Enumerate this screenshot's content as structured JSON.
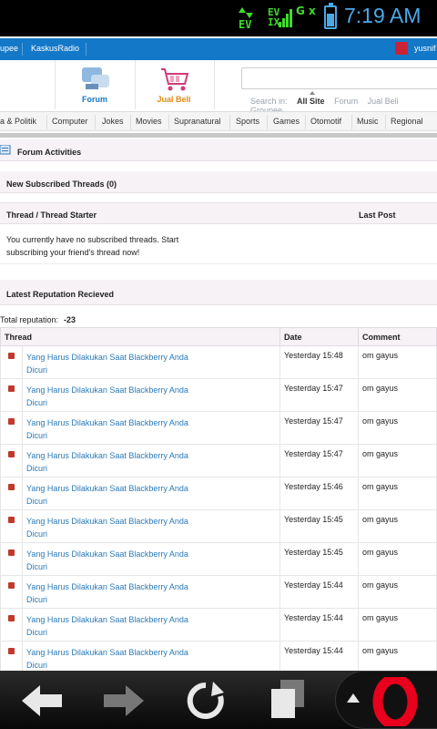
{
  "status": {
    "ev": "EV",
    "net": "EV\nIX",
    "gx": "G x",
    "time": "7:19 AM",
    "battery_level": 0.7
  },
  "topnav": {
    "items": [
      "upee",
      "KaskusRadio"
    ],
    "user": "yusnif"
  },
  "header": {
    "forum_label": "Forum",
    "jualbeli_label": "Jual Beli",
    "search_in": {
      "label": "Search in:",
      "options": [
        "All Site",
        "Forum",
        "Jual Beli",
        "Groupee"
      ]
    }
  },
  "categories": [
    "a & Politik",
    "Computer",
    "Jokes",
    "Movies",
    "Supranatural",
    "Sports",
    "Games",
    "Otomotif",
    "Music",
    "Regional"
  ],
  "forum_activities": "Forum Activities",
  "subscribed": {
    "title": "New Subscribed Threads (0)",
    "col_thread": "Thread / Thread Starter",
    "col_last": "Last Post",
    "message": "You currently have no subscribed threads. Start subscribing your friend's thread now!"
  },
  "reputation": {
    "title": "Latest Reputation Recieved",
    "total_label": "Total reputation:",
    "total_value": "-23",
    "columns": [
      "Thread",
      "Date",
      "Comment"
    ],
    "rows": [
      {
        "thread": "Yang Harus Dilakukan Saat Blackberry Anda Dicuri",
        "date": "Yesterday 15:48",
        "comment": "om gayus"
      },
      {
        "thread": "Yang Harus Dilakukan Saat Blackberry Anda Dicuri",
        "date": "Yesterday 15:47",
        "comment": "om gayus"
      },
      {
        "thread": "Yang Harus Dilakukan Saat Blackberry Anda Dicuri",
        "date": "Yesterday 15:47",
        "comment": "om gayus"
      },
      {
        "thread": "Yang Harus Dilakukan Saat Blackberry Anda Dicuri",
        "date": "Yesterday 15:47",
        "comment": "om gayus"
      },
      {
        "thread": "Yang Harus Dilakukan Saat Blackberry Anda Dicuri",
        "date": "Yesterday 15:46",
        "comment": "om gayus"
      },
      {
        "thread": "Yang Harus Dilakukan Saat Blackberry Anda Dicuri",
        "date": "Yesterday 15:45",
        "comment": "om gayus"
      },
      {
        "thread": "Yang Harus Dilakukan Saat Blackberry Anda Dicuri",
        "date": "Yesterday 15:45",
        "comment": "om gayus"
      },
      {
        "thread": "Yang Harus Dilakukan Saat Blackberry Anda Dicuri",
        "date": "Yesterday 15:44",
        "comment": "om gayus"
      },
      {
        "thread": "Yang Harus Dilakukan Saat Blackberry Anda Dicuri",
        "date": "Yesterday 15:44",
        "comment": "om gayus"
      },
      {
        "thread": "Yang Harus Dilakukan Saat Blackberry Anda Dicuri",
        "date": "Yesterday 15:44",
        "comment": "om gayus"
      }
    ]
  },
  "bottom_nav": [
    "back-icon",
    "forward-icon",
    "reload-icon",
    "tabs-icon",
    "opera-menu-icon"
  ],
  "colors": {
    "accent_blue": "#1478c8",
    "link": "#2a7ab8",
    "status_green": "#3fdc2a",
    "opera_red": "#e8001c"
  }
}
